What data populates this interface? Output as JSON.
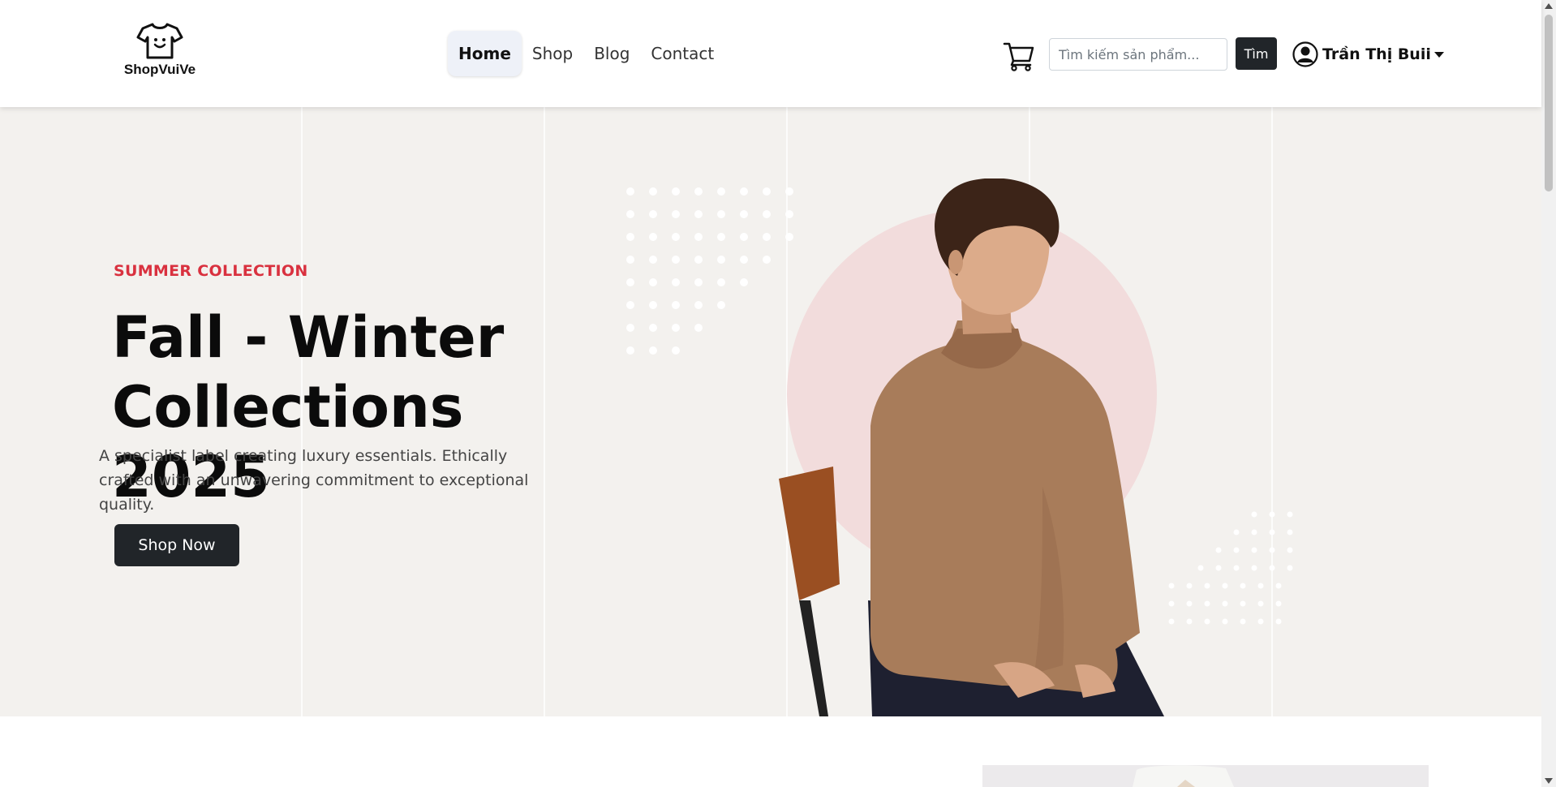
{
  "header": {
    "logo_text": "ShopVuiVe",
    "nav": [
      {
        "label": "Home",
        "active": true
      },
      {
        "label": "Shop",
        "active": false
      },
      {
        "label": "Blog",
        "active": false
      },
      {
        "label": "Contact",
        "active": false
      }
    ],
    "search_placeholder": "Tìm kiếm sản phẩm...",
    "search_button": "Tìm",
    "user_name": "Trần Thị Buii"
  },
  "hero": {
    "subtitle": "SUMMER COLLECTION",
    "title": "Fall - Winter Collections 2025",
    "description": "A specialist label creating luxury essentials. Ethically crafted with an unwavering commitment to exceptional quality.",
    "button": "Shop Now"
  },
  "colors": {
    "accent": "#d9313f",
    "dark_button": "#212529",
    "hero_bg": "#f3f1ee",
    "circle": "#f2dcdc"
  },
  "icons": [
    "tshirt-smile-icon",
    "cart-icon",
    "user-circle-icon",
    "caret-down-icon"
  ]
}
